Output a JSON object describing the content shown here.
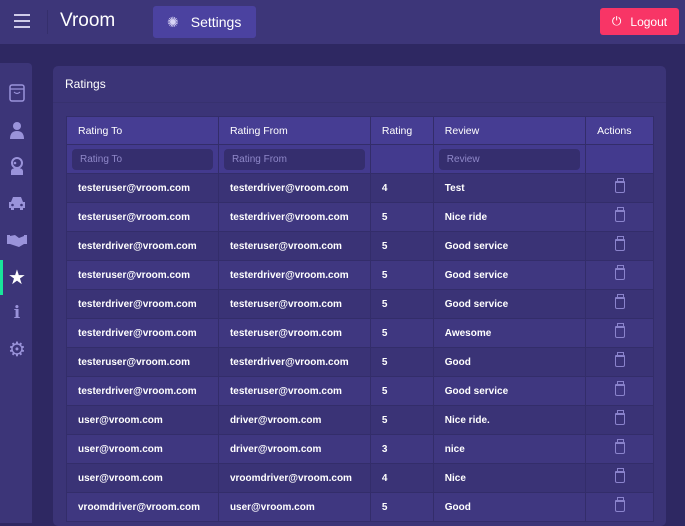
{
  "header": {
    "brand": "Vroom",
    "settings_label": "Settings",
    "logout_label": "Logout"
  },
  "sidebar": {
    "items": [
      "shop",
      "users",
      "drivers",
      "cars",
      "deals",
      "ratings",
      "info",
      "settings"
    ],
    "active": "ratings"
  },
  "card": {
    "title": "Ratings"
  },
  "table": {
    "columns": [
      "Rating To",
      "Rating From",
      "Rating",
      "Review",
      "Actions"
    ],
    "filters": {
      "rating_to": "Rating To",
      "rating_from": "Rating From",
      "review": "Review"
    },
    "rows": [
      [
        "testeruser@vroom.com",
        "testerdriver@vroom.com",
        "4",
        "Test"
      ],
      [
        "testeruser@vroom.com",
        "testerdriver@vroom.com",
        "5",
        "Nice ride"
      ],
      [
        "testerdriver@vroom.com",
        "testeruser@vroom.com",
        "5",
        "Good service"
      ],
      [
        "testeruser@vroom.com",
        "testerdriver@vroom.com",
        "5",
        "Good service"
      ],
      [
        "testerdriver@vroom.com",
        "testeruser@vroom.com",
        "5",
        "Good service"
      ],
      [
        "testerdriver@vroom.com",
        "testeruser@vroom.com",
        "5",
        "Awesome"
      ],
      [
        "testeruser@vroom.com",
        "testerdriver@vroom.com",
        "5",
        "Good"
      ],
      [
        "testerdriver@vroom.com",
        "testeruser@vroom.com",
        "5",
        "Good service"
      ],
      [
        "user@vroom.com",
        "driver@vroom.com",
        "5",
        "Nice ride."
      ],
      [
        "user@vroom.com",
        "driver@vroom.com",
        "3",
        "nice"
      ],
      [
        "user@vroom.com",
        "vroomdriver@vroom.com",
        "4",
        "Nice"
      ],
      [
        "vroomdriver@vroom.com",
        "user@vroom.com",
        "5",
        "Good"
      ]
    ]
  }
}
